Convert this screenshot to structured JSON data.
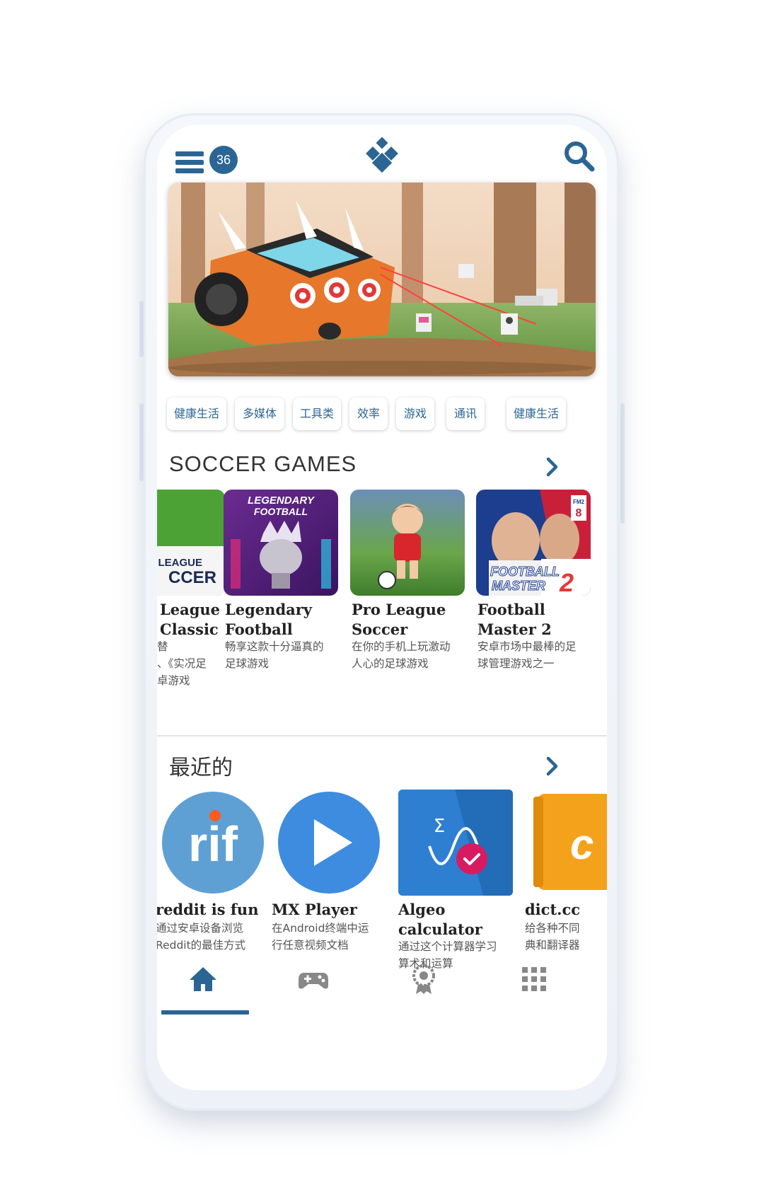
{
  "header": {
    "notification_count": "36"
  },
  "categories": [
    "健康生活",
    "多媒体",
    "工具类",
    "效率",
    "游戏",
    "通讯",
    "健康生活"
  ],
  "soccer_section": {
    "title": "SOCCER GAMES",
    "apps": [
      {
        "name_line1": "League",
        "name_line2": "Classic",
        "desc_line1": "替",
        "desc_line2": "、《实况足",
        "desc_line3": "卓游戏",
        "icon_text_top": "LEAGUE",
        "icon_text_bottom": "CCER"
      },
      {
        "name_line1": "Legendary",
        "name_line2": "Football",
        "desc_line1": "畅享这款十分逼真的",
        "desc_line2": "足球游戏",
        "icon_text_top": "LEGENDARY",
        "icon_text_bottom": "FOOTBALL"
      },
      {
        "name_line1": "Pro League",
        "name_line2": "Soccer",
        "desc_line1": "在你的手机上玩激动",
        "desc_line2": "人心的足球游戏"
      },
      {
        "name_line1": "Football",
        "name_line2": "Master 2",
        "desc_line1": "安卓市场中最棒的足",
        "desc_line2": "球管理游戏之一",
        "icon_text_top": "FOOTBALL",
        "icon_text_bottom": "MASTER",
        "icon_number": "2",
        "icon_tag": "FM2",
        "icon_tag_num": "8"
      }
    ]
  },
  "recent_section": {
    "title": "最近的",
    "apps": [
      {
        "name_line1": "reddit is fun",
        "desc_line1": "通过安卓设备浏览",
        "desc_line2": "Reddit的最佳方式",
        "icon_text": "rif"
      },
      {
        "name_line1": "MX Player",
        "desc_line1": "在Android终端中运",
        "desc_line2": "行任意视频文档"
      },
      {
        "name_line1": "Algeo",
        "name_line2": "calculator",
        "desc_line1": "通过这个计算器学习",
        "desc_line2": "算术和运算",
        "icon_text": "Σ"
      },
      {
        "name_line1": "dict.cc",
        "desc_line1": "给各种不同",
        "desc_line2": "典和翻译器"
      }
    ]
  },
  "colors": {
    "accent": "#2b6594",
    "chip_text": "#2b6594",
    "section_title": "#333333"
  },
  "icons": {
    "menu": "menu-icon",
    "logo": "diamond-logo-icon",
    "search": "search-icon",
    "chevron": "chevron-right-icon",
    "home": "home-icon",
    "games": "gamepad-icon",
    "awards": "award-icon",
    "apps": "grid-icon"
  },
  "bottom_nav": {
    "active_index": 0
  }
}
